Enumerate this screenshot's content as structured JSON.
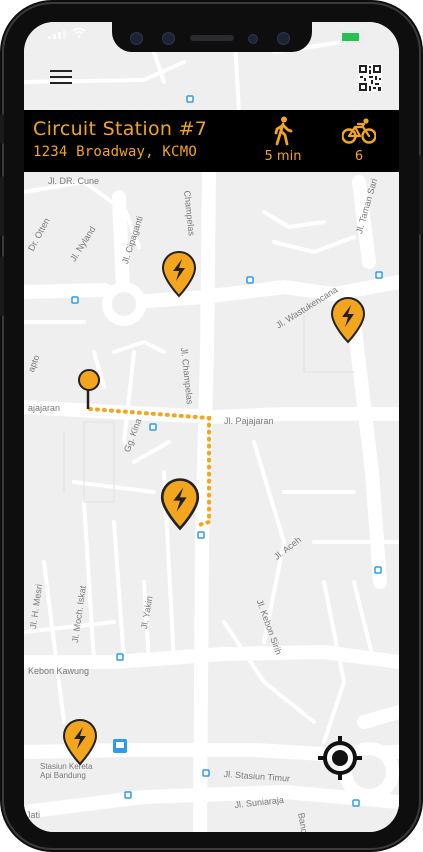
{
  "header": {
    "station_name": "Circuit Station #7",
    "station_address": "1234 Broadway, KCMO",
    "walk_time": "5 min",
    "bike_count": "6"
  },
  "icons": {
    "menu": "hamburger-menu-icon",
    "qr": "qr-code-icon",
    "walk": "walking-person-icon",
    "bike": "bicycle-icon",
    "charging_pin": "lightning-pin-icon",
    "origin": "origin-pin-icon",
    "locate": "crosshair-locate-icon"
  },
  "colors": {
    "accent": "#f4a51e",
    "info_bar": "#000000",
    "map_background": "#efefef",
    "road": "#ffffff",
    "battery": "#25c24f"
  },
  "map": {
    "street_labels": [
      "Jl. DR. Cune",
      "Jl. Nyland",
      "Jl. Cipaganti",
      "Champelas",
      "Dr. Otten",
      "Jl. Wastukencana",
      "Jl. Champelas",
      "Jl. Pajajaran",
      "ajajaran",
      "Gg. Kina",
      "Jl. Aceh",
      "Jl. Kebon Sirih",
      "Jl. H. Mesri",
      "Jl. Moch. Iskat",
      "Jl. Yakin",
      "Kebon Kawung",
      "Jl. Stasiun Timur",
      "Jl. Suniaraja",
      "Jl. Taman Sari",
      "Banceuy",
      "Jati",
      "Stasiun Kereta Api Bandung",
      "apto"
    ]
  }
}
